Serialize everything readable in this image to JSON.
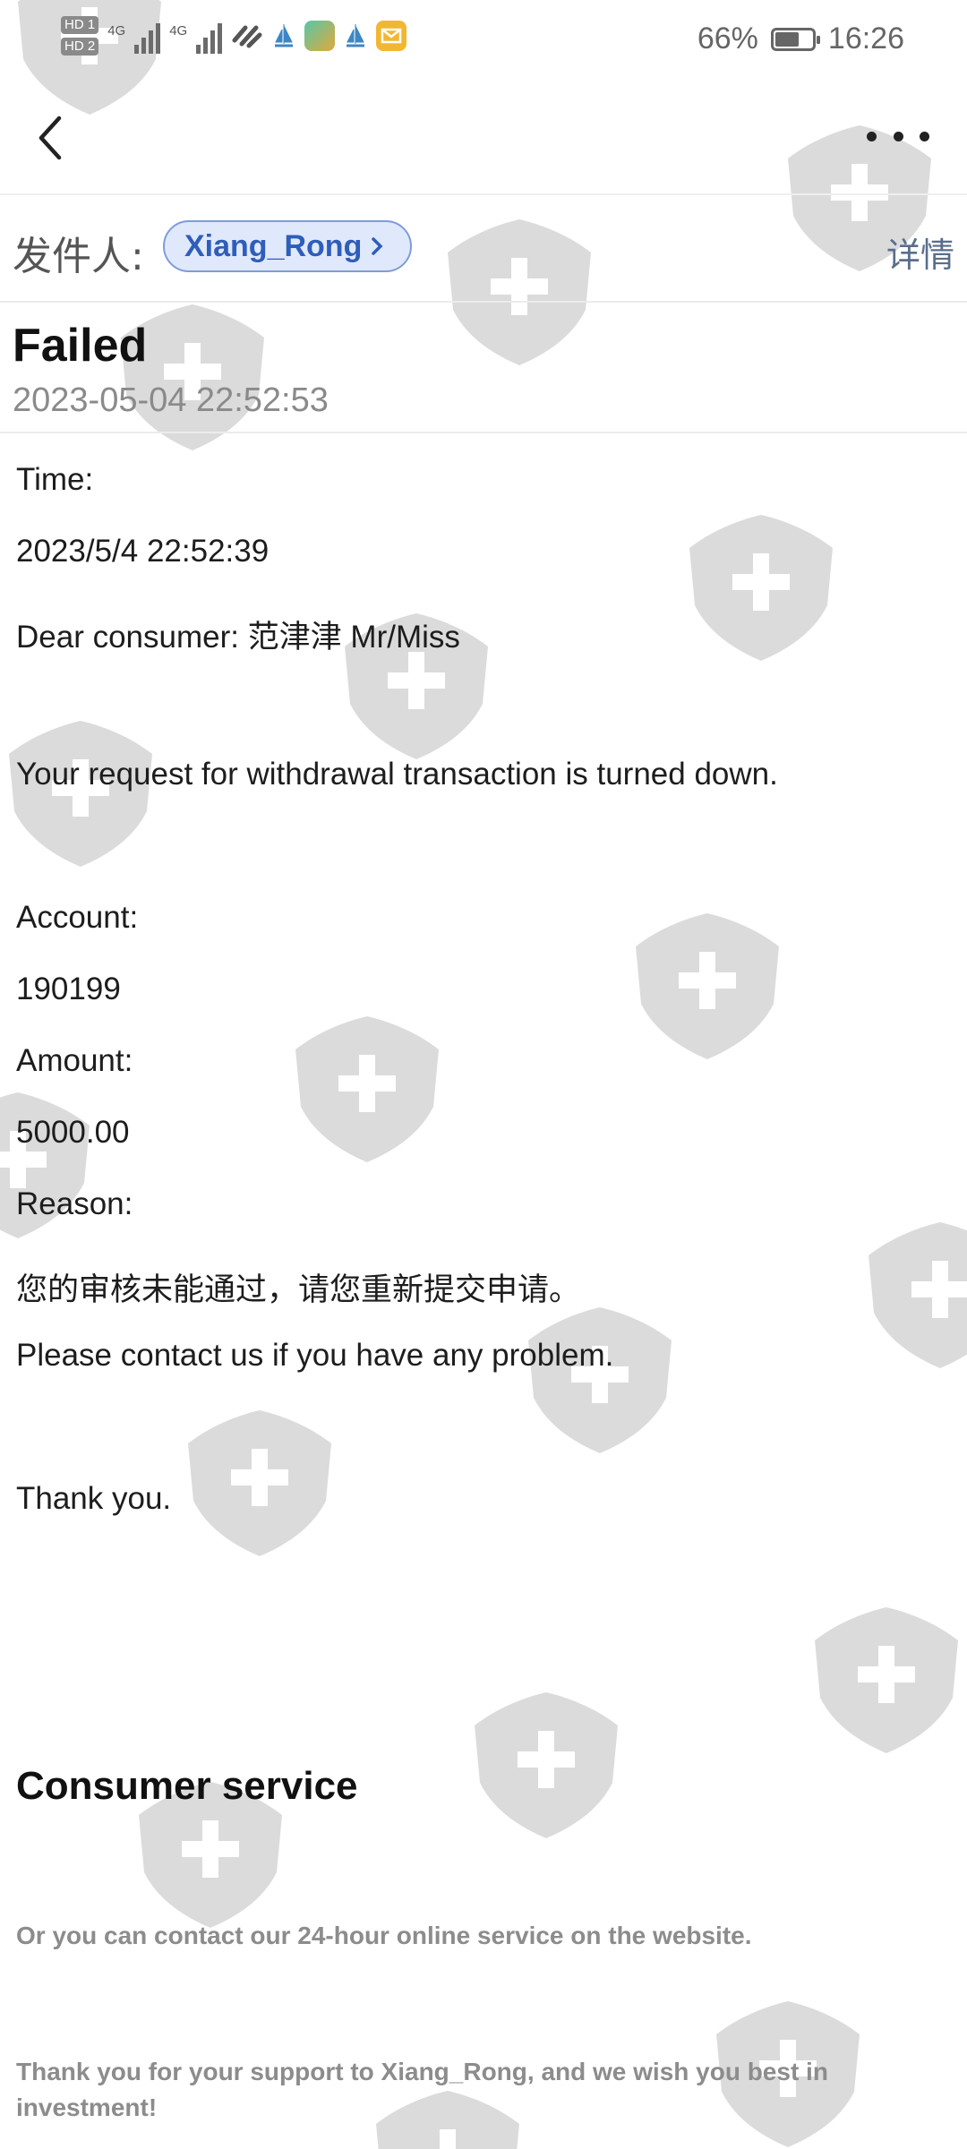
{
  "status_bar": {
    "hd_labels": [
      "HD 1",
      "HD 2"
    ],
    "network_labels": [
      "4G",
      "4G"
    ],
    "battery_percent": "66%",
    "battery_level": 0.66,
    "time": "16:26"
  },
  "toolbar": {
    "back_icon": "chevron-left-icon",
    "more_icon": "more-horizontal-icon"
  },
  "sender": {
    "label": "发件人:",
    "name": "Xiang_Rong",
    "details_label": "详情"
  },
  "message": {
    "subject": "Failed",
    "date": "2023-05-04 22:52:53",
    "lines": {
      "time_label": "Time:",
      "time_value": "2023/5/4 22:52:39",
      "greeting": "Dear consumer: 范津津  Mr/Miss",
      "notice": "Your request for withdrawal transaction is turned down.",
      "account_label": "Account:",
      "account_value": "190199",
      "amount_label": "Amount:",
      "amount_value": "5000.00",
      "reason_label": "Reason:",
      "reason_value": "您的审核未能通过，请您重新提交申请。",
      "contact": "Please contact us if you have any problem.",
      "thanks": "Thank you."
    },
    "service_heading": "Consumer service",
    "service_line": "Or you can contact our 24-hour online service on the website.",
    "closing_line": "Thank you for your support to Xiang_Rong, and we wish you best in investment!"
  },
  "colors": {
    "chip_bg": "#dfe9fb",
    "chip_text": "#2f5dba",
    "watermark": "#d6d6d6"
  }
}
